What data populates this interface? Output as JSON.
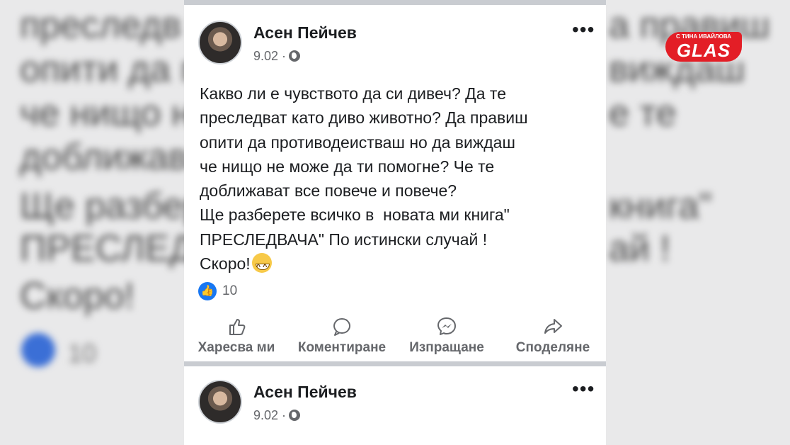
{
  "background": {
    "lines": [
      "преследв",
      "опити да п",
      "че нищо н",
      "доближав",
      "Ще разбер",
      "ПРЕСЛЕД",
      "Скоро!"
    ],
    "right_lines": [
      "а правиш",
      "виждаш",
      "е те",
      "",
      "книга\"",
      "ай !"
    ],
    "like_count": "10"
  },
  "logo": {
    "small_text": "С ТИНА ИВАЙЛОВА",
    "big_text": "GLAS"
  },
  "posts": [
    {
      "author": "Асен Пейчев",
      "date": "9.02 ·",
      "more": "•••",
      "text": "Какво ли е чувството да си дивеч? Да те\nпреследват като диво животно? Да правиш\nопити да противодеистваш но да виждаш\nче нищо не може да ти помогне? Че те\nдоближават все повече и повече?\nЩе разберете всичко в  новата ми книга\"\nПРЕСЛЕДВАЧА\" По истински случай !\nСкоро!",
      "emoji": "grinning-face-icon",
      "reaction_count": "10",
      "actions": {
        "like": "Харесва ми",
        "comment": "Коментиране",
        "send": "Изпращане",
        "share": "Споделяне"
      }
    },
    {
      "author": "Асен Пейчев",
      "date": "9.02 ·",
      "more": "•••"
    }
  ],
  "colors": {
    "facebook_blue": "#1877f2",
    "logo_red": "#e31e26"
  }
}
